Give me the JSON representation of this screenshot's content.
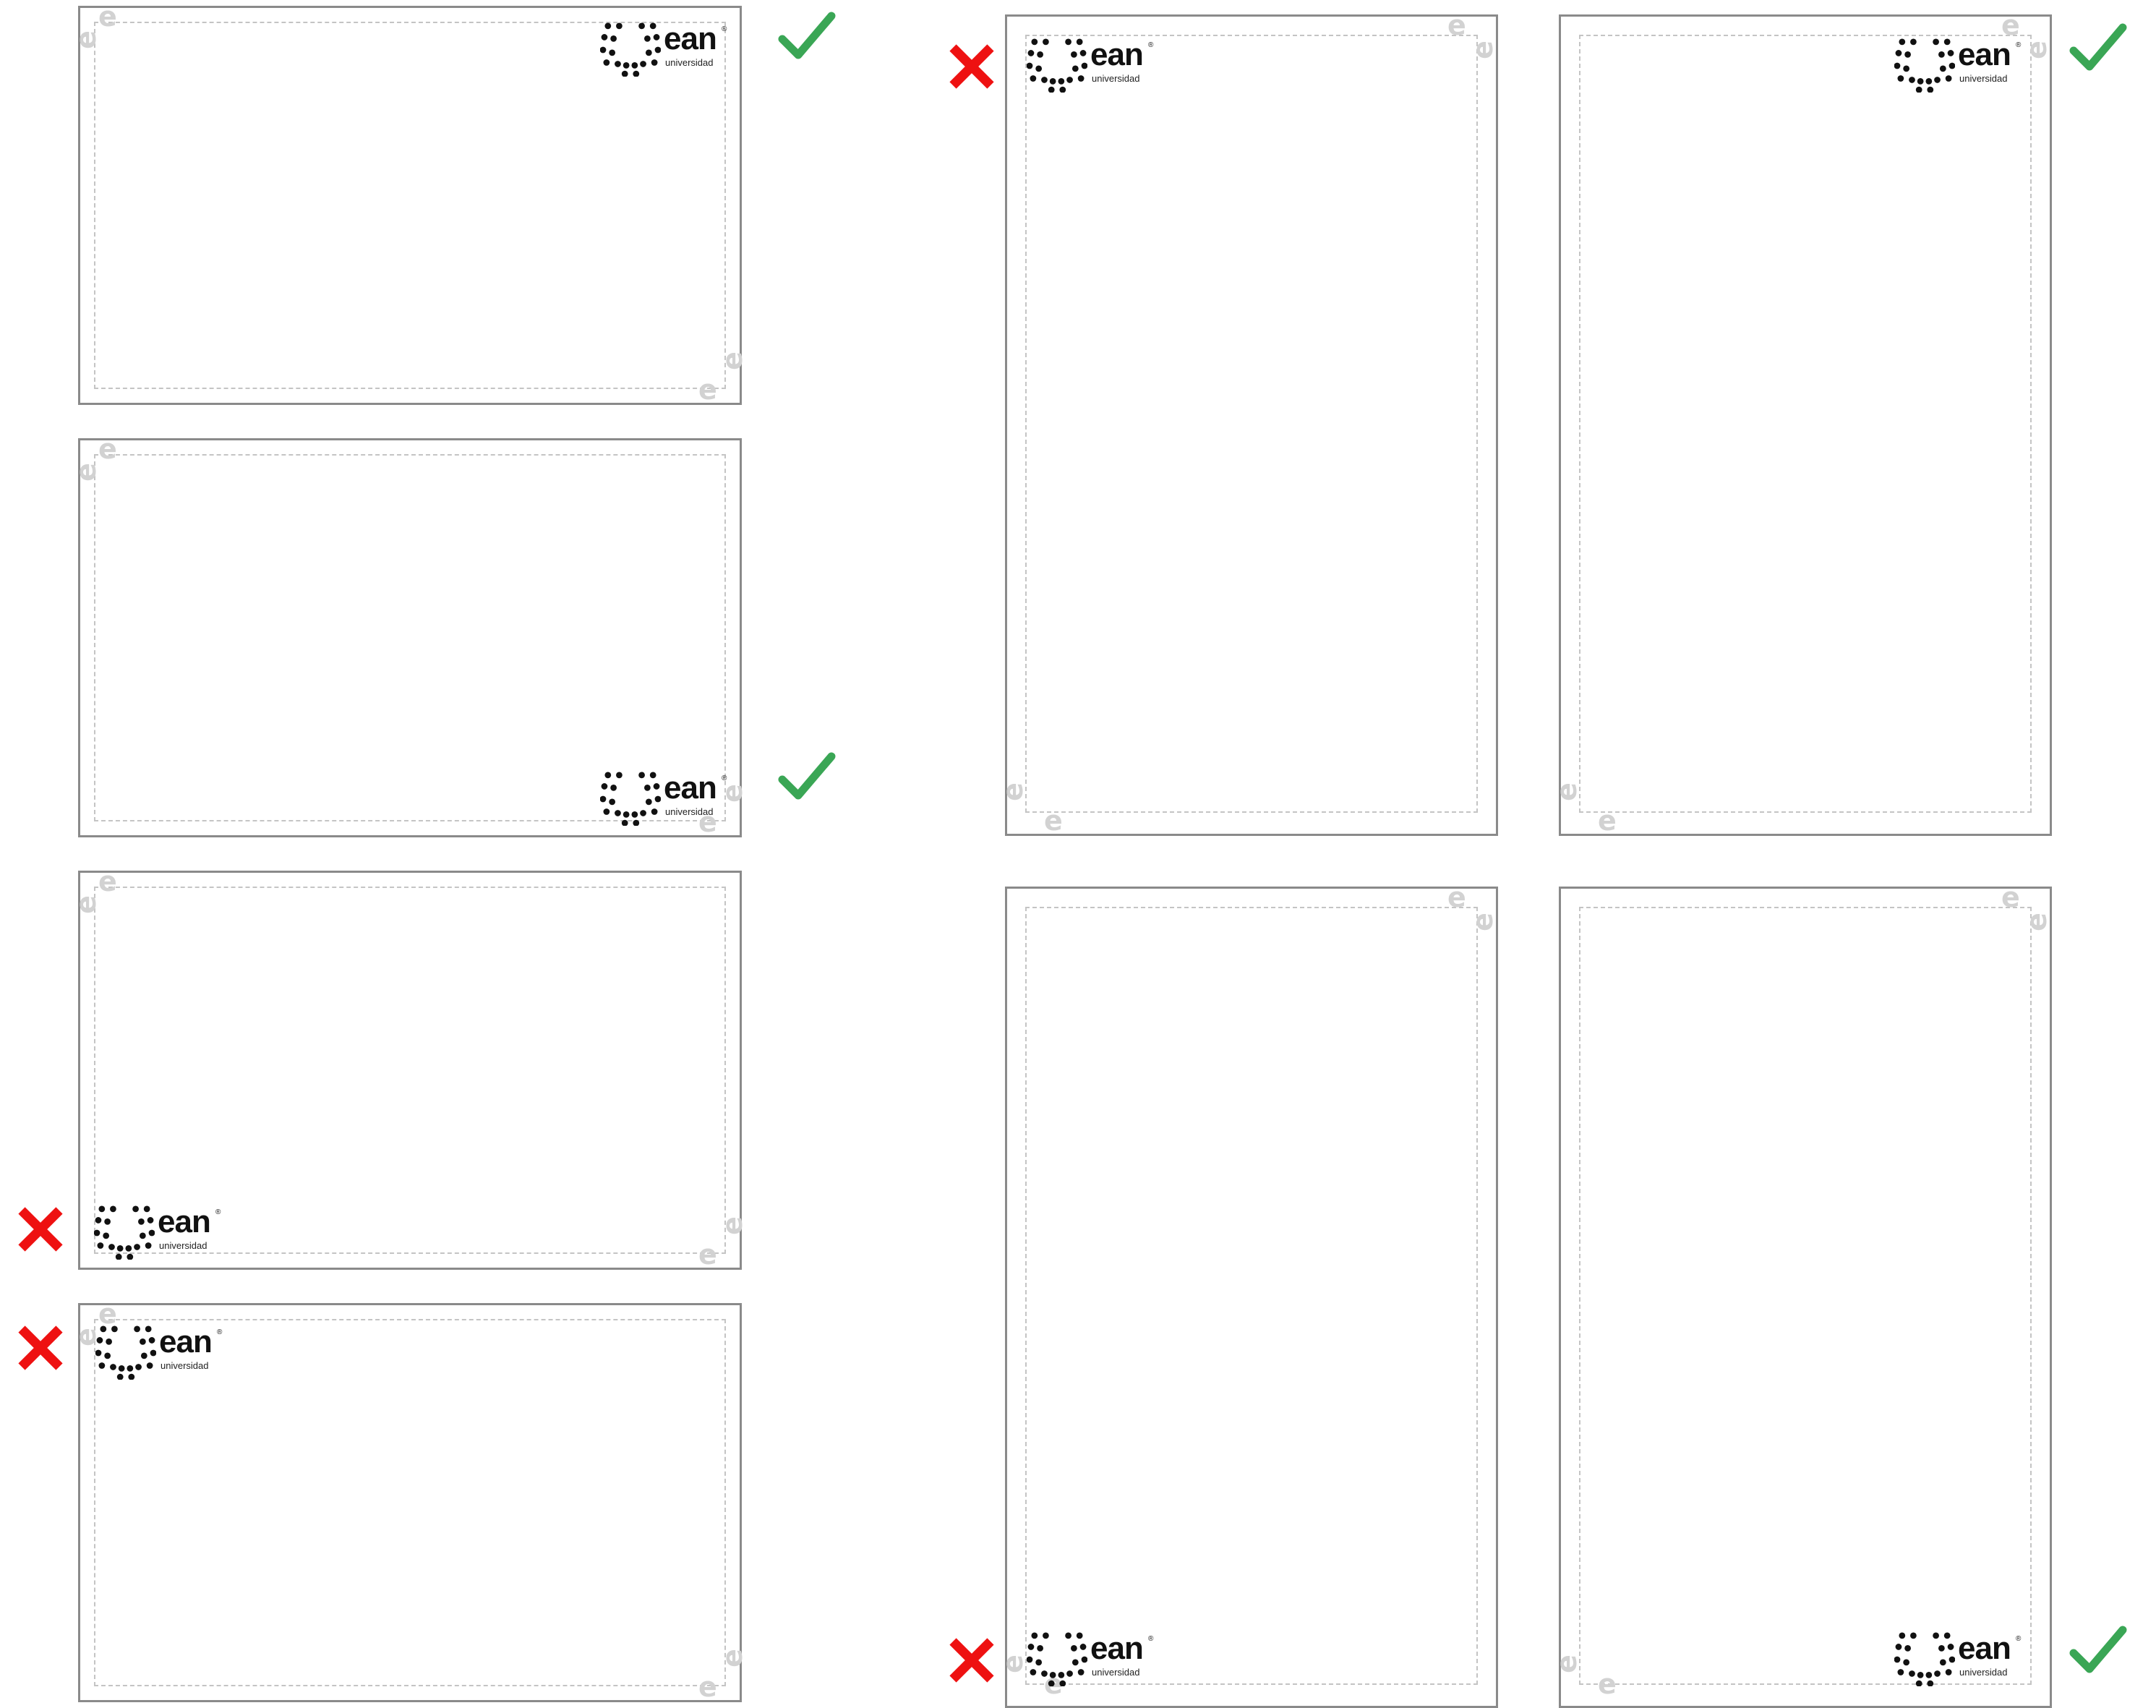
{
  "brand": {
    "wordmark": "ean",
    "registered": "®",
    "sub": "universidad",
    "ghost_letter": "e"
  },
  "colors": {
    "correct": "#3aa655",
    "incorrect": "#ee1111",
    "frame": "#8a8a8a",
    "safe_area": "#c4c4c4"
  },
  "examples": [
    {
      "id": "landscape-1",
      "orientation": "landscape",
      "logo_position": "top-right",
      "verdict": "correct",
      "icon": "check-icon"
    },
    {
      "id": "landscape-2",
      "orientation": "landscape",
      "logo_position": "bottom-right",
      "verdict": "correct",
      "icon": "check-icon"
    },
    {
      "id": "landscape-3",
      "orientation": "landscape",
      "logo_position": "bottom-left",
      "verdict": "incorrect",
      "icon": "cross-icon"
    },
    {
      "id": "landscape-4",
      "orientation": "landscape",
      "logo_position": "top-left",
      "verdict": "incorrect",
      "icon": "cross-icon"
    },
    {
      "id": "portrait-1",
      "orientation": "portrait",
      "logo_position": "top-left",
      "verdict": "incorrect",
      "icon": "cross-icon"
    },
    {
      "id": "portrait-2",
      "orientation": "portrait",
      "logo_position": "top-right",
      "verdict": "correct",
      "icon": "check-icon"
    },
    {
      "id": "portrait-3",
      "orientation": "portrait",
      "logo_position": "bottom-left",
      "verdict": "incorrect",
      "icon": "cross-icon"
    },
    {
      "id": "portrait-4",
      "orientation": "portrait",
      "logo_position": "bottom-right",
      "verdict": "correct",
      "icon": "check-icon"
    }
  ]
}
